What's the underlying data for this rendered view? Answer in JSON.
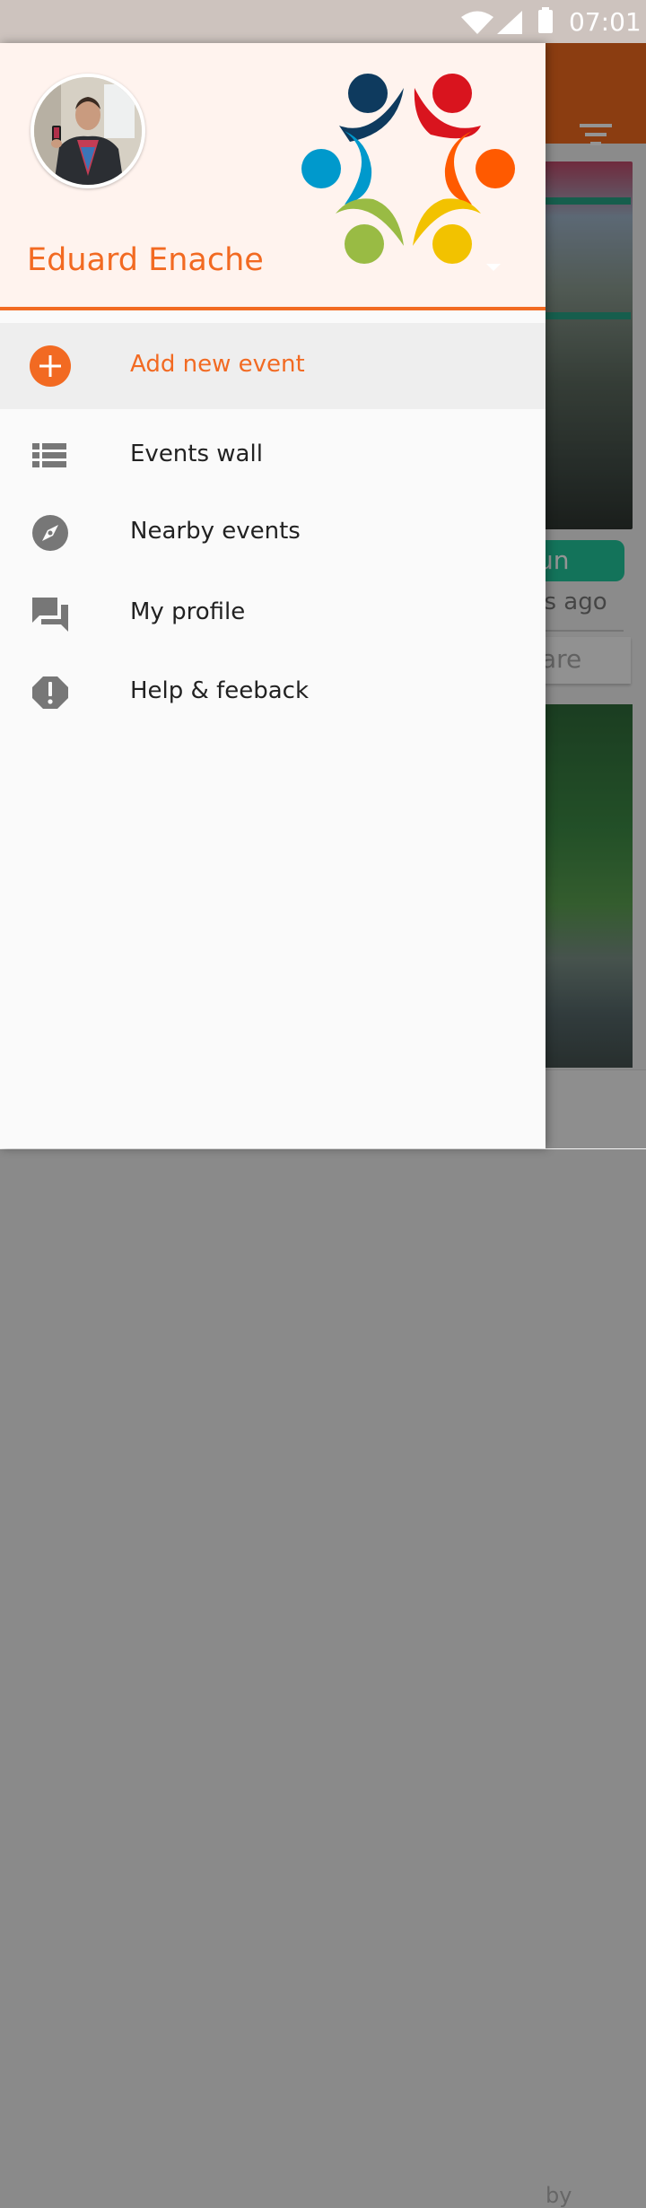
{
  "status_bar": {
    "time": "07:01"
  },
  "drawer": {
    "user_name": "Eduard Enache",
    "menu": [
      {
        "label": "Add new event",
        "icon": "add-circle-icon",
        "active": true
      },
      {
        "label": "Events wall",
        "icon": "list-icon"
      },
      {
        "label": "Nearby events",
        "icon": "compass-icon"
      },
      {
        "label": "My profile",
        "icon": "chat-icon"
      },
      {
        "label": "Help & feeback",
        "icon": "alert-icon"
      }
    ]
  },
  "background": {
    "card_chip": "un",
    "card_time": "ns ago",
    "card_action": "are",
    "bottom_nav_label": "by"
  },
  "colors": {
    "accent": "#f26a22",
    "header_bg": "#fff3ee",
    "status_bar": "#cdc3be",
    "chip_green": "#22c79b"
  }
}
